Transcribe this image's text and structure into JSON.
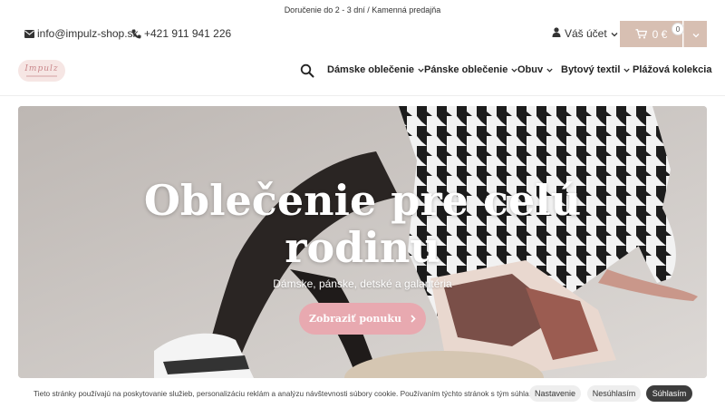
{
  "topbar": {
    "text": "Doručenie do 2 - 3 dní / Kamenná predajňa"
  },
  "contact": {
    "email": "info@impulz-shop.sk",
    "phone": "+421 911 941 226"
  },
  "account": {
    "label": "Váš účet"
  },
  "cart": {
    "total": "0 €",
    "count": "0"
  },
  "logo": {
    "name": "Impulz"
  },
  "nav": {
    "items": [
      {
        "label": "Dámske oblečenie",
        "icon": "chevron-down-icon"
      },
      {
        "label": "Pánske oblečenie",
        "icon": "chevron-down-icon"
      },
      {
        "label": "Obuv",
        "icon": "chevron-down-icon"
      },
      {
        "label": "Bytový textil",
        "icon": "chevron-down-icon"
      },
      {
        "label": "Plážová kolekcia"
      }
    ]
  },
  "hero": {
    "title_line1": "Oblečenie pre celú",
    "title_line2": "rodinu",
    "subtitle": "Dámske, pánske, detské a galantéria",
    "button": "Zobraziť ponuku"
  },
  "cookie": {
    "text": "Tieto stránky používajú na poskytovanie služieb, personalizáciu reklám a analýzu návštevnosti súbory cookie. Používaním týchto stránok s tým súhlasíte.",
    "settings": "Nastavenie",
    "reject": "Nesúhlasím",
    "accept": "Súhlasím"
  },
  "colors": {
    "accent": "#d7bfb2",
    "button_pink": "#e8a9b0",
    "accept_dark": "#3d3d3d"
  },
  "icons": [
    "envelope-icon",
    "phone-icon",
    "user-icon",
    "cart-icon",
    "search-icon",
    "chevron-down-icon",
    "chevron-right-icon"
  ]
}
